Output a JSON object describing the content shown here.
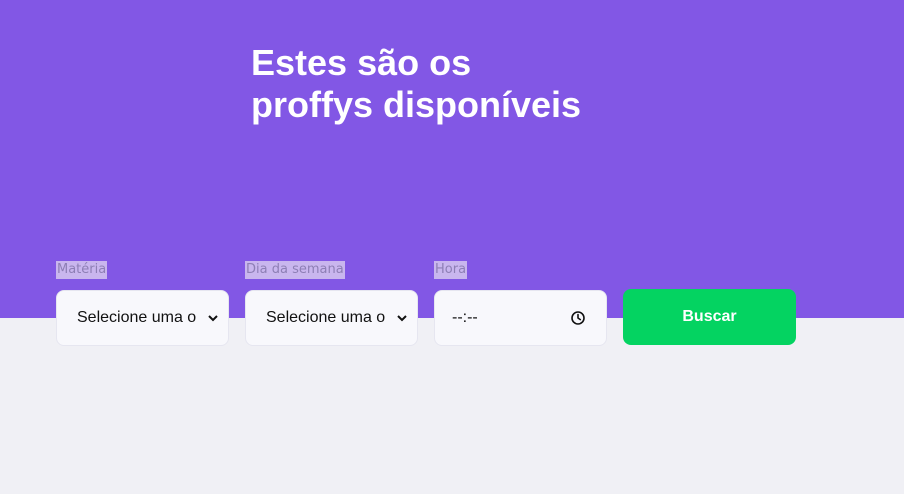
{
  "header": {
    "title_line1": "Estes são os",
    "title_line2": "proffys disponíveis"
  },
  "filters": {
    "subject": {
      "label": "Matéria",
      "value": "Selecione uma o"
    },
    "weekday": {
      "label": "Dia da semana",
      "value": "Selecione uma o"
    },
    "time": {
      "label": "Hora",
      "value": "--:--"
    }
  },
  "search_button": {
    "label": "Buscar"
  },
  "icons": {
    "select_arrow": "chevron-down-icon",
    "time_picker": "clock-icon"
  },
  "colors": {
    "hero_background": "#8257e5",
    "page_background": "#f0f0f5",
    "button_background": "#04d361",
    "input_background": "#f8f8fc"
  }
}
